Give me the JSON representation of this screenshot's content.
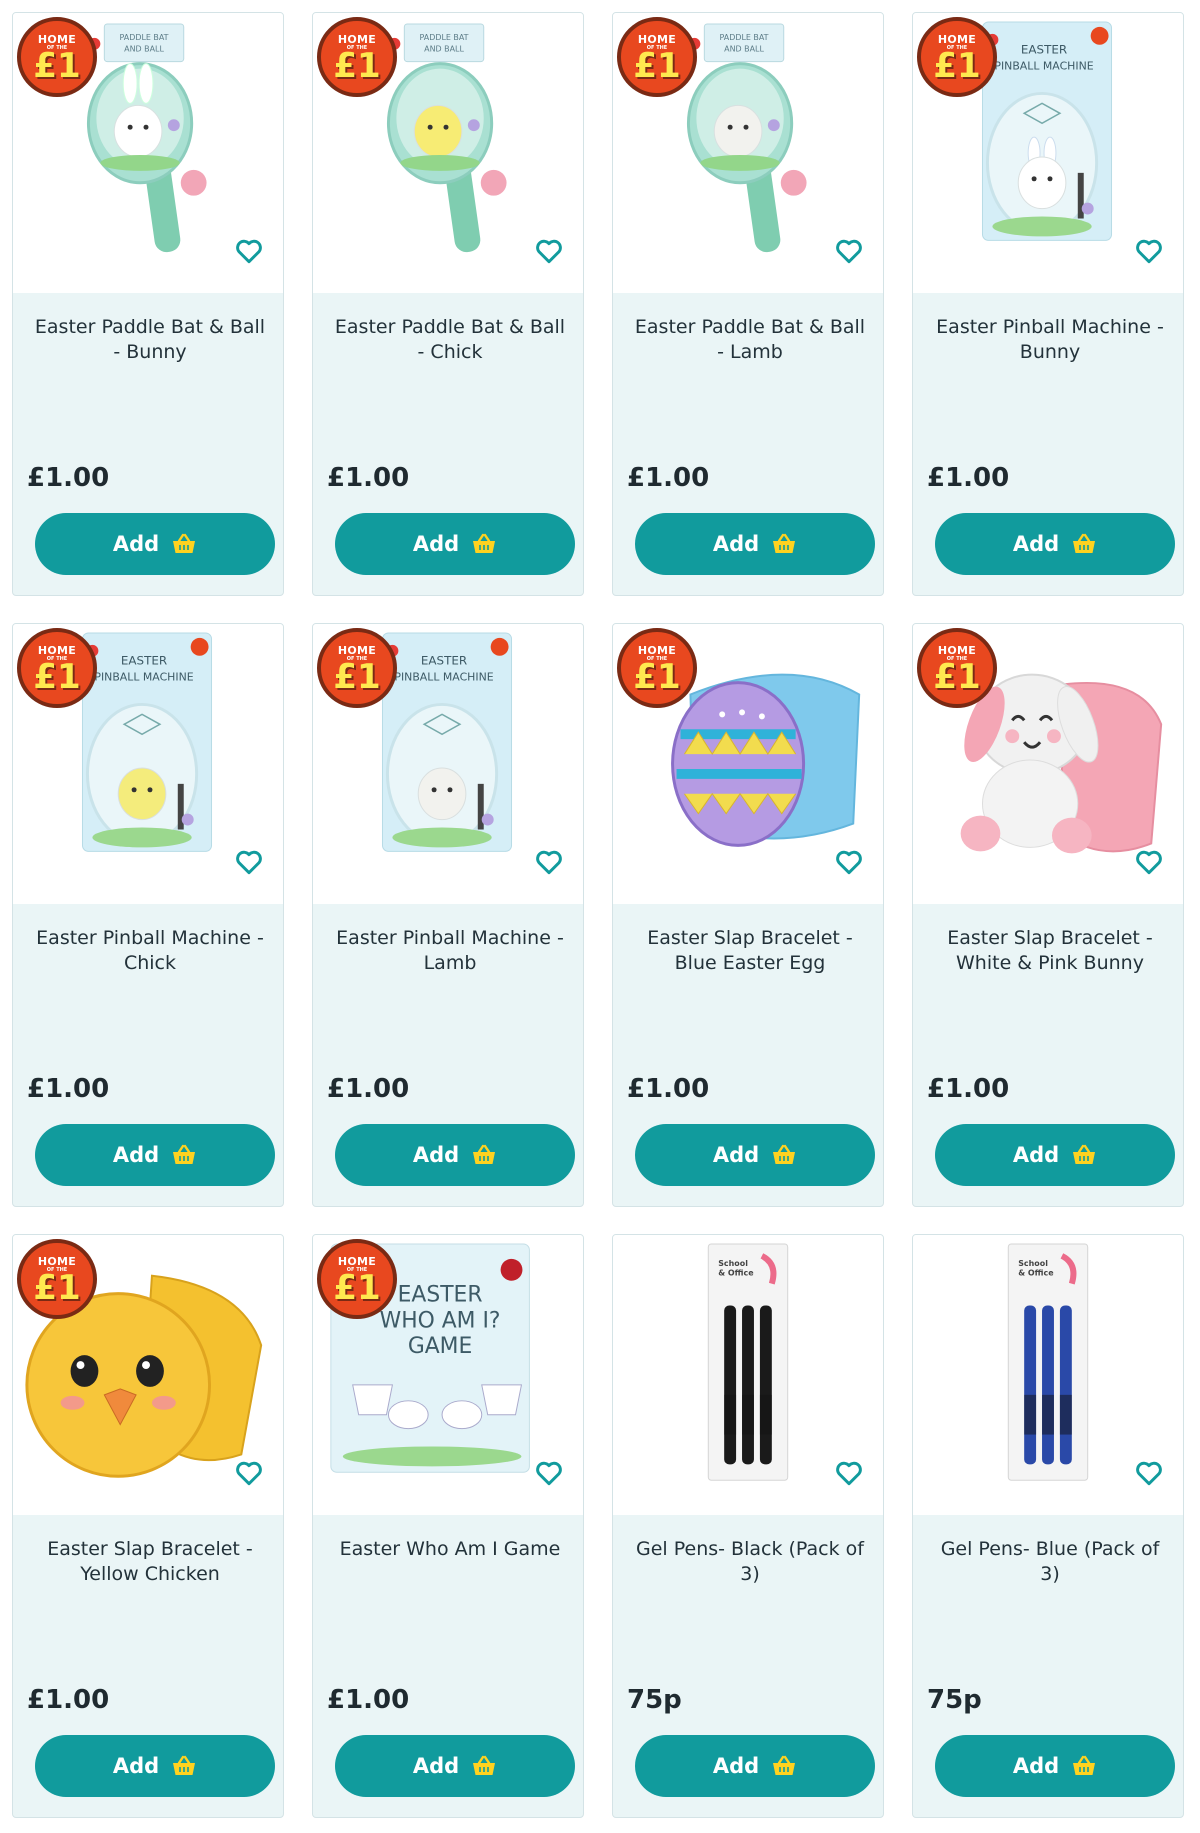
{
  "badge": {
    "top": "HOME",
    "mid": "OF THE",
    "main": "£1"
  },
  "button_label": "Add",
  "icons": {
    "wishlist": "heart-outline-icon",
    "basket": "basket-icon"
  },
  "colors": {
    "accent": "#119b9d",
    "badge": "#e8481f",
    "card_bg": "#eaf5f6"
  },
  "products": [
    {
      "name": "Easter Paddle Bat & Ball - Bunny",
      "price": "£1.00",
      "badge": true
    },
    {
      "name": "Easter Paddle Bat & Ball - Chick",
      "price": "£1.00",
      "badge": true
    },
    {
      "name": "Easter Paddle Bat & Ball - Lamb",
      "price": "£1.00",
      "badge": true
    },
    {
      "name": "Easter Pinball Machine - Bunny",
      "price": "£1.00",
      "badge": true
    },
    {
      "name": "Easter Pinball Machine - Chick",
      "price": "£1.00",
      "badge": true
    },
    {
      "name": "Easter Pinball Machine - Lamb",
      "price": "£1.00",
      "badge": true
    },
    {
      "name": "Easter Slap Bracelet - Blue Easter Egg",
      "price": "£1.00",
      "badge": true
    },
    {
      "name": "Easter Slap Bracelet - White & Pink Bunny",
      "price": "£1.00",
      "badge": true
    },
    {
      "name": "Easter Slap Bracelet - Yellow Chicken",
      "price": "£1.00",
      "badge": true
    },
    {
      "name": "Easter Who Am I Game",
      "price": "£1.00",
      "badge": true
    },
    {
      "name": "Gel Pens- Black (Pack of 3)",
      "price": "75p",
      "badge": false
    },
    {
      "name": "Gel Pens- Blue (Pack of 3)",
      "price": "75p",
      "badge": false
    }
  ],
  "packaging_text": {
    "paddle": [
      "PADDLE BAT",
      "AND BALL"
    ],
    "pinball": [
      "EASTER",
      "PINBALL MACHINE"
    ],
    "who_am_i": [
      "EASTER",
      "WHO AM I?",
      "GAME"
    ],
    "pens": [
      "School",
      "& Office"
    ]
  }
}
